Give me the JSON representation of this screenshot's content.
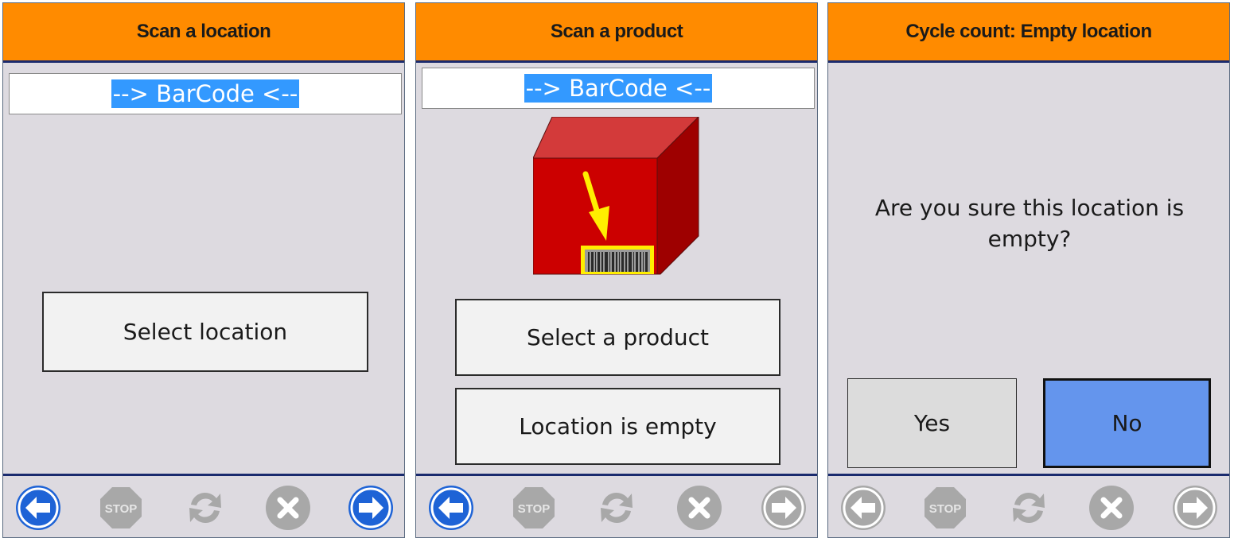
{
  "screen_scan_location": {
    "title": "Scan a location",
    "barcode_value": "--> BarCode <--",
    "select_location_label": "Select location"
  },
  "screen_scan_product": {
    "title": "Scan a product",
    "barcode_value": "--> BarCode <--",
    "select_product_label": "Select a product",
    "location_empty_label": "Location is empty"
  },
  "screen_confirm_empty": {
    "title": "Cycle count: Empty location",
    "question": "Are you sure this location is empty?",
    "yes_label": "Yes",
    "no_label": "No"
  },
  "toolbar": {
    "buttons": [
      "back-icon",
      "stop-icon",
      "refresh-icon",
      "cancel-icon",
      "forward-icon"
    ],
    "stop_text": "STOP"
  },
  "colors": {
    "header": "#ff8b00",
    "header_rule": "#1a2a6e",
    "panel_bg": "#dddae0",
    "selection": "#3399ff",
    "active_nav": "#1e63d6",
    "disabled_icon": "#a8a8a8",
    "no_button": "#6495ed"
  }
}
